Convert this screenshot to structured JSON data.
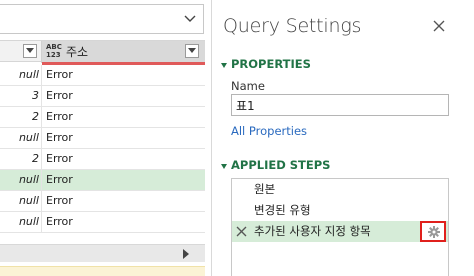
{
  "grid": {
    "column2_type_icon": "ABC\n123",
    "column2_name": "주소",
    "rows": [
      {
        "value": "null",
        "status": "Error",
        "selected": false
      },
      {
        "value": "3",
        "status": "Error",
        "selected": false
      },
      {
        "value": "2",
        "status": "Error",
        "selected": false
      },
      {
        "value": "null",
        "status": "Error",
        "selected": false
      },
      {
        "value": "2",
        "status": "Error",
        "selected": false
      },
      {
        "value": "null",
        "status": "Error",
        "selected": true
      },
      {
        "value": "null",
        "status": "Error",
        "selected": false
      },
      {
        "value": "null",
        "status": "Error",
        "selected": false
      }
    ],
    "icons": {
      "formula_expand": "chevron-down-icon",
      "scroll_right": "triangle-right-icon",
      "column_filter": "filter-dropdown-icon"
    }
  },
  "query_settings": {
    "title": "Query Settings",
    "close_icon": "close-icon",
    "properties_section": "PROPERTIES",
    "name_label": "Name",
    "name_value": "표1",
    "all_properties_link": "All Properties",
    "applied_steps_section": "APPLIED STEPS",
    "steps": [
      {
        "label": "원본",
        "active": false
      },
      {
        "label": "변경된 유형",
        "active": false
      },
      {
        "label": "추가된 사용자 지정 항목",
        "active": true
      }
    ],
    "step_settings_icon": "gear-icon",
    "step_delete_icon": "delete-x-icon"
  },
  "colors": {
    "accent_green": "#217346",
    "selected_row": "#d6ecd8",
    "error_header_bar": "#e05a5a",
    "highlight_box": "#e0201c",
    "link_blue": "#2a6abf"
  }
}
